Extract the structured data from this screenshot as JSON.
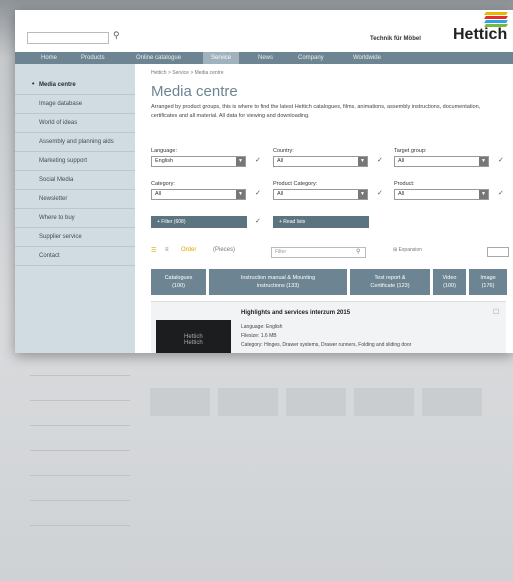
{
  "topbar": {
    "search_icon": "search-icon",
    "slogan": "Technik für Möbel",
    "logo_text": "Hettich"
  },
  "nav": {
    "items": [
      "Home",
      "Products",
      "Online catalogue",
      "Service",
      "News",
      "Company",
      "Worldwide"
    ],
    "active_index": 3
  },
  "breadcrumb": "Hettich  >  Service  >  Media centre",
  "page": {
    "title": "Media centre",
    "intro": "Arranged by product groups, this is where to find the latest Hettich catalogues, films, animations, assembly instructions, documentation, certificates and all material. All data for viewing and downloading."
  },
  "sidebar": {
    "items": [
      "Media centre",
      "Image database",
      "World of ideas",
      "Assembly and planning aids",
      "Marketing support",
      "Social Media",
      "Newsletter",
      "Where to buy",
      "Supplier service",
      "Contact"
    ],
    "active_index": 0
  },
  "filters": {
    "language": {
      "label": "Language:",
      "value": "English"
    },
    "country": {
      "label": "Country:",
      "value": "All"
    },
    "target_group": {
      "label": "Target group:",
      "value": "All"
    },
    "category": {
      "label": "Category:",
      "value": "All"
    },
    "product_category": {
      "label": "Product Category:",
      "value": "All"
    },
    "product": {
      "label": "Product:",
      "value": "All"
    }
  },
  "buttons": {
    "filter": "+ Filter (608)",
    "read_lists": "+ Read lists"
  },
  "toolbar": {
    "items": [
      "Order",
      "(Pieces)"
    ],
    "search_placeholder": "Filter",
    "expand_label": "Expansion"
  },
  "tabs": [
    {
      "label": "Catalogues",
      "count": "(100)"
    },
    {
      "label": "Instruction manual & Mounting",
      "count": "instructions (133)"
    },
    {
      "label": "Test report &",
      "count": "Certificate (123)"
    },
    {
      "label": "Video",
      "count": "(100)"
    },
    {
      "label": "Image",
      "count": "(176)"
    }
  ],
  "card": {
    "title": "Highlights and services   interzum 2015",
    "language": "Language: English",
    "size": "Filesize: 1.6 MB",
    "categories": "Category: Hinges, Drawer systems, Drawer runners, Folding and sliding door",
    "thumb_logo_top": "Hettich",
    "thumb_logo_bottom": "Hettich"
  },
  "colors": {
    "nav": "#6d8592",
    "accent": "#6d8592",
    "sidebar_bg": "#d1dce2",
    "logo_stripes": [
      "#f0b400",
      "#e3302f",
      "#2aa7df",
      "#7bb93c"
    ]
  }
}
